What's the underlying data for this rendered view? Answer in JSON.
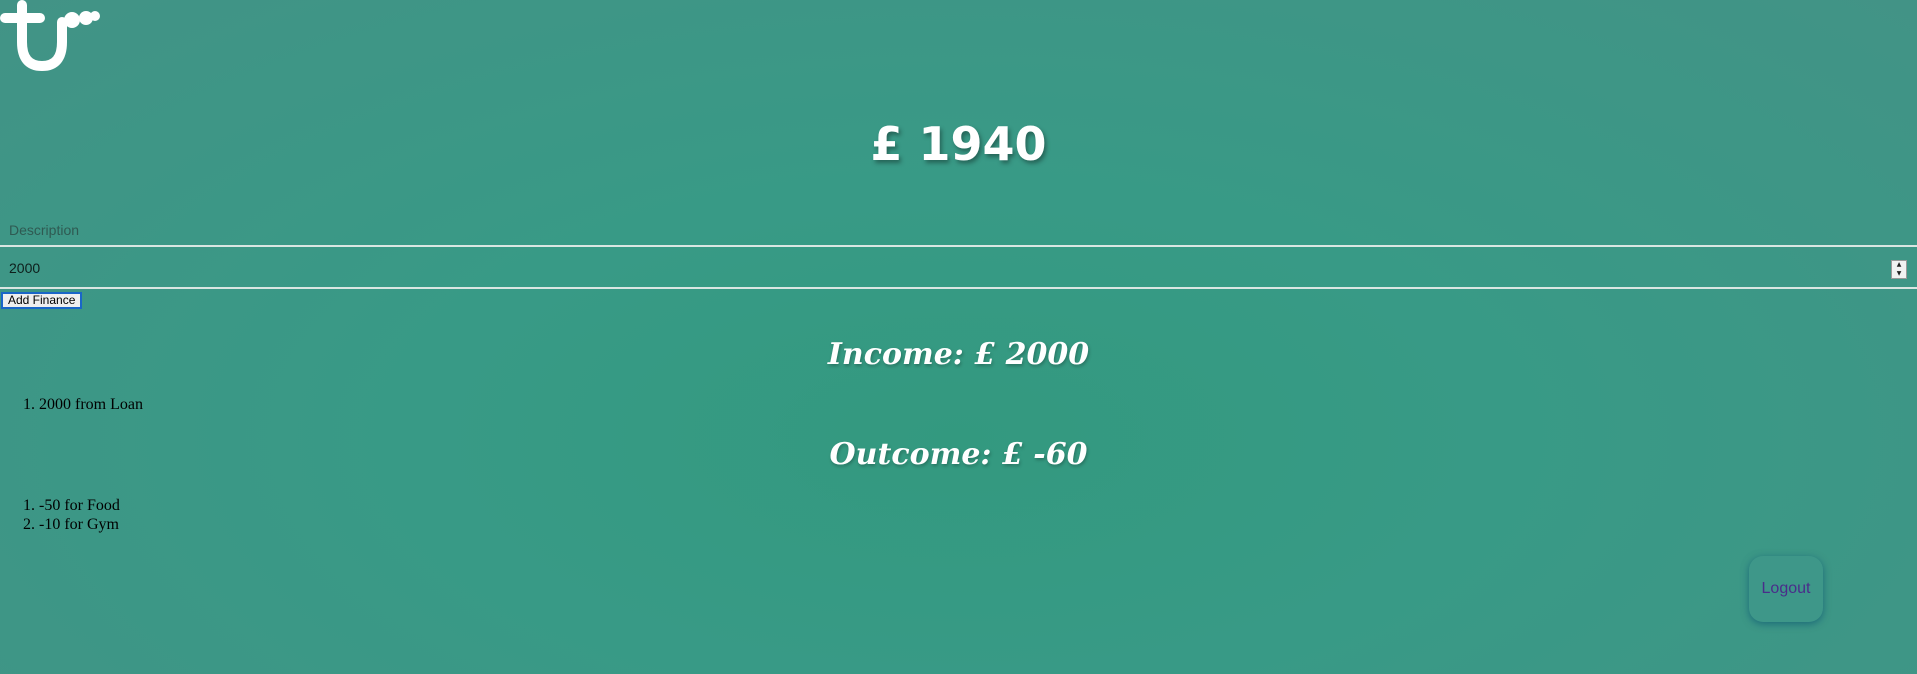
{
  "logo": {
    "icon": "tu-logo-icon",
    "color": "#ffffff"
  },
  "balance": {
    "text": "£ 1940"
  },
  "form": {
    "description_placeholder": "Description",
    "amount_value": "2000",
    "add_button_label": "Add Finance"
  },
  "income": {
    "title": "Income: £ 2000",
    "items": [
      "2000 from Loan"
    ]
  },
  "outcome": {
    "title": "Outcome: £ -60",
    "items": [
      "-50 for Food",
      "-10 for Gym"
    ]
  },
  "logout": {
    "label": "Logout"
  },
  "colors": {
    "background": "#3a9885",
    "title_text": "#ffffff",
    "logout_text": "#4a2d8a",
    "focus_border": "#1a66c8"
  }
}
